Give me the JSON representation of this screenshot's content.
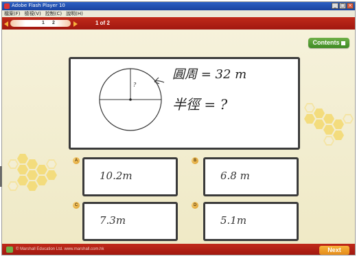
{
  "window": {
    "title": "Adobe Flash Player 10",
    "buttons": [
      "_",
      "□",
      "×"
    ]
  },
  "menubar": {
    "items": [
      "檔案(F)",
      "檢視(V)",
      "控制(C)",
      "說明(H)"
    ]
  },
  "nav": {
    "page_current": "1",
    "page_next": "2",
    "page_count": "1 of 2",
    "prev_icon": "arrow-left-icon",
    "next_icon": "arrow-right-icon"
  },
  "contents_button": "Contents",
  "question": {
    "circle_mark": "?",
    "line1": "圓周 = 32 m",
    "line2": "半徑 = ?"
  },
  "answers": [
    {
      "letter": "A",
      "text": "10.2m"
    },
    {
      "letter": "B",
      "text": "6.8 m"
    },
    {
      "letter": "C",
      "text": "7.3m"
    },
    {
      "letter": "D",
      "text": "5.1m"
    }
  ],
  "footer": {
    "copyright": "© Marshall Education Ltd. www.marshall.com.hk",
    "next_button": "Next"
  },
  "colors": {
    "bar_red": "#b22214",
    "accent_orange": "#f7b23b",
    "contents_green": "#4f9b30",
    "stage_cream": "#f3eed4"
  }
}
